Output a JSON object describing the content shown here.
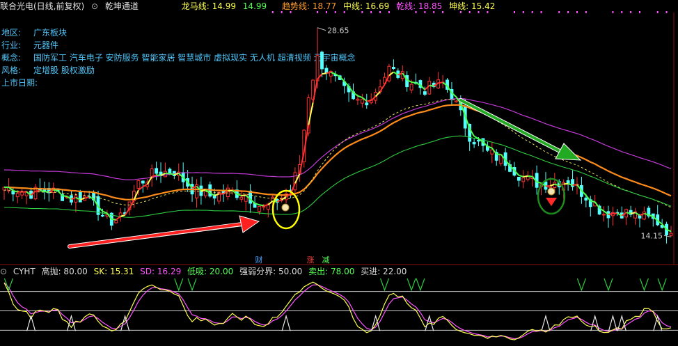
{
  "header": {
    "stock_title": "联合光电(日线,前复权)",
    "indicator_name": "乾坤通道",
    "longma_label": "龙马线: 14.99",
    "longma_val2": "14.99",
    "trend_label": "趋势线: 18.77",
    "mid_label": "中线: 16.69",
    "qian_label": "乾线: 18.85",
    "kun_label": "坤线: 15.42"
  },
  "info": {
    "rows": [
      {
        "label": "地区:",
        "value": "广东板块"
      },
      {
        "label": "行业:",
        "value": "元器件"
      },
      {
        "label": "概念:",
        "value": "国防军工 汽车电子 安防服务 智能家居 智慧城市 虚拟现实 无人机 超清视频 元宇宙概念"
      },
      {
        "label": "风格:",
        "value": "定增股 股权激励"
      },
      {
        "label": "上市日期:",
        "value": ""
      }
    ]
  },
  "markers": {
    "cai": "财",
    "zhang": "涨",
    "jian": "减"
  },
  "indicator": {
    "name": "CYHT",
    "gaopao": "高抛: 80.00",
    "sk": "SK: 15.31",
    "sd": "SD: 16.29",
    "dixi": "低吸: 20.00",
    "qiangruo": "强弱分界: 50.00",
    "maichu": "卖出: 78.00",
    "mairu": "买进: 22.00"
  },
  "colors": {
    "up": "#ff3232",
    "down": "#54ffff",
    "green_line": "#2ecc40",
    "orange_line": "#ff8c1a",
    "magenta_line": "#c23ad6",
    "yellow_dash": "#e8e05a",
    "red_arrow": "#ff2020",
    "green_arrow": "#22aa22"
  },
  "chart_data": {
    "type": "candlestick",
    "x_count": 150,
    "ylim": [
      13.2,
      29.6
    ],
    "price_labels": {
      "high": "28.65",
      "low": "14.15"
    },
    "high_value": 28.65,
    "low_value": 14.15,
    "close_anchors": [
      [
        0,
        17.6
      ],
      [
        6,
        17.2
      ],
      [
        10,
        17.4
      ],
      [
        15,
        16.8
      ],
      [
        20,
        17.0
      ],
      [
        22,
        15.2
      ],
      [
        26,
        15.4
      ],
      [
        30,
        17.9
      ],
      [
        34,
        18.6
      ],
      [
        38,
        18.7
      ],
      [
        42,
        17.5
      ],
      [
        46,
        17.0
      ],
      [
        50,
        17.3
      ],
      [
        54,
        17.1
      ],
      [
        58,
        16.1
      ],
      [
        62,
        16.9
      ],
      [
        64,
        17.4
      ],
      [
        66,
        19.2
      ],
      [
        68,
        24.0
      ],
      [
        70,
        26.5
      ],
      [
        74,
        25.0
      ],
      [
        78,
        23.5
      ],
      [
        82,
        23.8
      ],
      [
        86,
        25.8
      ],
      [
        90,
        25.0
      ],
      [
        94,
        24.4
      ],
      [
        98,
        24.8
      ],
      [
        100,
        24.0
      ],
      [
        104,
        21.2
      ],
      [
        108,
        20.0
      ],
      [
        112,
        19.4
      ],
      [
        116,
        18.2
      ],
      [
        120,
        17.8
      ],
      [
        124,
        18.0
      ],
      [
        126,
        18.1
      ],
      [
        130,
        17.0
      ],
      [
        134,
        15.8
      ],
      [
        138,
        15.9
      ],
      [
        142,
        15.6
      ],
      [
        146,
        15.2
      ],
      [
        149,
        14.4
      ]
    ],
    "series": [
      {
        "name": "龙马线",
        "type": "line",
        "smooth": 3
      },
      {
        "name": "趋势线",
        "type": "line",
        "smooth": 26
      },
      {
        "name": "中线",
        "type": "line",
        "smooth": 40
      },
      {
        "name": "乾线",
        "type": "line",
        "smooth": 30
      },
      {
        "name": "坤线",
        "type": "line",
        "smooth": 55
      }
    ],
    "indicator_panel": {
      "ylim": [
        0,
        100
      ],
      "levels": [
        80,
        50,
        20
      ],
      "sell_spikes_x": [
        1,
        39,
        42,
        85,
        91,
        93,
        129,
        135,
        143,
        147
      ],
      "buy_spikes_x": [
        6,
        15,
        27,
        63,
        83,
        95,
        121,
        132,
        136,
        138,
        146
      ]
    }
  }
}
